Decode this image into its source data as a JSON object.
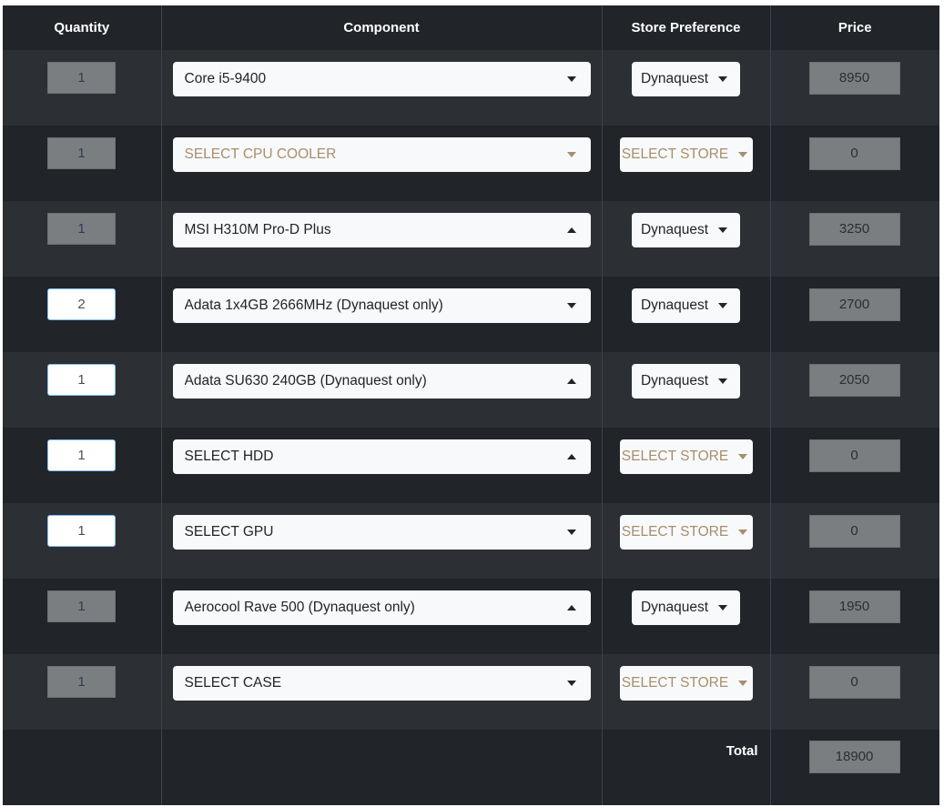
{
  "headers": {
    "quantity": "Quantity",
    "component": "Component",
    "store": "Store Preference",
    "price": "Price"
  },
  "rows": [
    {
      "qty": "1",
      "qty_editable": false,
      "component": "Core i5-9400",
      "component_placeholder": false,
      "caret": "down",
      "store": "Dynaquest",
      "store_placeholder": false,
      "price": "8950"
    },
    {
      "qty": "1",
      "qty_editable": false,
      "component": "SELECT CPU COOLER",
      "component_placeholder": true,
      "caret": "down",
      "store": "SELECT STORE",
      "store_placeholder": true,
      "price": "0"
    },
    {
      "qty": "1",
      "qty_editable": false,
      "component": "MSI H310M Pro-D Plus",
      "component_placeholder": false,
      "caret": "up",
      "store": "Dynaquest",
      "store_placeholder": false,
      "price": "3250"
    },
    {
      "qty": "2",
      "qty_editable": true,
      "component": "Adata 1x4GB 2666MHz (Dynaquest only)",
      "component_placeholder": false,
      "caret": "down",
      "store": "Dynaquest",
      "store_placeholder": false,
      "price": "2700"
    },
    {
      "qty": "1",
      "qty_editable": true,
      "component": "Adata SU630 240GB (Dynaquest only)",
      "component_placeholder": false,
      "caret": "up",
      "store": "Dynaquest",
      "store_placeholder": false,
      "price": "2050"
    },
    {
      "qty": "1",
      "qty_editable": true,
      "component": "SELECT HDD",
      "component_placeholder": false,
      "caret": "up",
      "store": "SELECT STORE",
      "store_placeholder": true,
      "price": "0"
    },
    {
      "qty": "1",
      "qty_editable": true,
      "component": "SELECT GPU",
      "component_placeholder": false,
      "caret": "down",
      "store": "SELECT STORE",
      "store_placeholder": true,
      "price": "0"
    },
    {
      "qty": "1",
      "qty_editable": false,
      "component": "Aerocool Rave 500 (Dynaquest only)",
      "component_placeholder": false,
      "caret": "up",
      "store": "Dynaquest",
      "store_placeholder": false,
      "price": "1950"
    },
    {
      "qty": "1",
      "qty_editable": false,
      "component": "SELECT CASE",
      "component_placeholder": false,
      "caret": "down",
      "store": "SELECT STORE",
      "store_placeholder": true,
      "price": "0"
    }
  ],
  "total": {
    "label": "Total",
    "value": "18900"
  },
  "colors": {
    "header_bg": "#212529",
    "row_odd_bg": "#2c3034",
    "row_even_bg": "#212529",
    "placeholder_text": "#a78e6c",
    "disabled_field": "#7b7e81",
    "select_bg": "#f8f9fa"
  }
}
